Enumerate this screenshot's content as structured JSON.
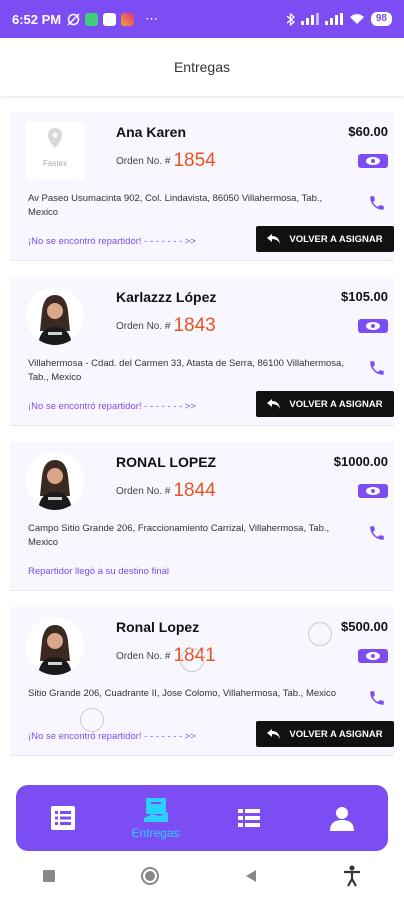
{
  "status_bar": {
    "time": "6:52 PM",
    "more": "⋯",
    "battery": "98"
  },
  "header": {
    "title": "Entregas"
  },
  "orders": [
    {
      "name": "Ana Karen",
      "price": "$60.00",
      "order_label": "Orden No. #",
      "order_number": "1854",
      "address": "Av Paseo Usumacinta 902, Col. Lindavista, 86050 Villahermosa, Tab., Mexico",
      "status": "¡No se encontró repartidor! - - - - - - - >>",
      "button": "VOLVER A ASIGNAR",
      "avatar": "logo",
      "logo_text": "Fastex"
    },
    {
      "name": "Karlazzz López",
      "price": "$105.00",
      "order_label": "Orden No. #",
      "order_number": "1843",
      "address": "Villahermosa - Cdad. del Carmen 33, Atasta de Serra, 86100 Villahermosa, Tab., Mexico",
      "status": "¡No se encontró repartidor! - - - - - - - >>",
      "button": "VOLVER A ASIGNAR",
      "avatar": "photo"
    },
    {
      "name": "RONAL LOPEZ",
      "price": "$1000.00",
      "order_label": "Orden No. #",
      "order_number": "1844",
      "address": "Campo Sitio Grande 206, Fraccionamiento Carrizal, Villahermosa, Tab., Mexico",
      "status": "Repartidor llegó a su destino final",
      "button": "",
      "avatar": "photo"
    },
    {
      "name": "Ronal Lopez",
      "price": "$500.00",
      "order_label": "Orden No. #",
      "order_number": "1841",
      "address": "Sitio Grande 206, Cuadrante II, Jose Colomo, Villahermosa, Tab., Mexico",
      "status": "¡No se encontró repartidor! - - - - - - - >>",
      "button": "VOLVER A ASIGNAR",
      "avatar": "photo"
    }
  ],
  "bottom_nav": {
    "items": [
      {
        "icon": "list-icon",
        "label": ""
      },
      {
        "icon": "delivery-icon",
        "label": "Entregas",
        "active": true
      },
      {
        "icon": "menu-list-icon",
        "label": ""
      },
      {
        "icon": "user-icon",
        "label": ""
      }
    ]
  },
  "colors": {
    "accent": "#7b4df2",
    "order_number": "#e8541f",
    "active_nav_label": "#2ad0ff"
  }
}
